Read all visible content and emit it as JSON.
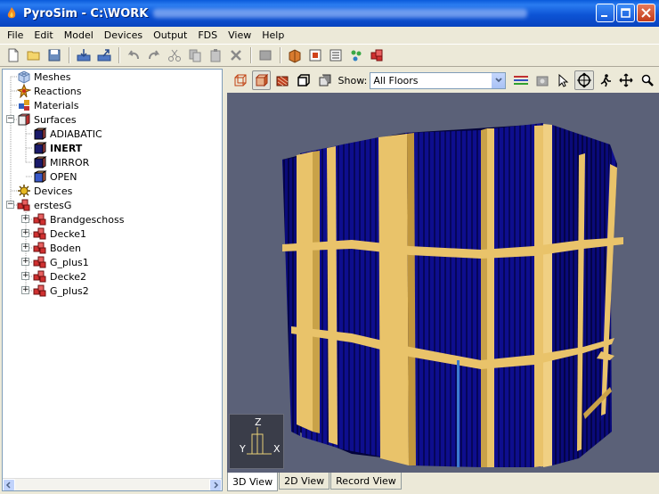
{
  "window": {
    "title": "PyroSim - C:\\WORK"
  },
  "menu": [
    "File",
    "Edit",
    "Model",
    "Devices",
    "Output",
    "FDS",
    "View",
    "Help"
  ],
  "toolbar": {
    "icons": [
      "new-file-icon",
      "open-folder-icon",
      "save-icon",
      "import-icon",
      "export-icon",
      "undo-icon",
      "redo-icon",
      "cut-icon",
      "copy-icon",
      "paste-icon",
      "delete-icon",
      "properties-icon",
      "new-obstruction-icon",
      "new-hole-icon",
      "new-vent-icon",
      "new-particle-icon",
      "new-group-icon"
    ]
  },
  "tree": {
    "items": [
      {
        "label": "Meshes",
        "icon": "mesh-icon",
        "level": 0
      },
      {
        "label": "Reactions",
        "icon": "reaction-icon",
        "level": 0
      },
      {
        "label": "Materials",
        "icon": "material-icon",
        "level": 0
      },
      {
        "label": "Surfaces",
        "icon": "surface-icon",
        "level": 0,
        "expanded": true
      },
      {
        "label": "ADIABATIC",
        "icon": "surface-adiabatic-icon",
        "level": 1
      },
      {
        "label": "INERT",
        "icon": "surface-inert-icon",
        "level": 1,
        "selected": true
      },
      {
        "label": "MIRROR",
        "icon": "surface-mirror-icon",
        "level": 1
      },
      {
        "label": "OPEN",
        "icon": "surface-open-icon",
        "level": 1
      },
      {
        "label": "Devices",
        "icon": "device-icon",
        "level": 0
      },
      {
        "label": "erstesG",
        "icon": "group-icon",
        "level": 0,
        "expanded": true
      },
      {
        "label": "Brandgeschoss",
        "icon": "group-icon",
        "level": 1
      },
      {
        "label": "Decke1",
        "icon": "group-icon",
        "level": 1
      },
      {
        "label": "Boden",
        "icon": "group-icon",
        "level": 1
      },
      {
        "label": "G_plus1",
        "icon": "group-icon",
        "level": 1
      },
      {
        "label": "Decke2",
        "icon": "group-icon",
        "level": 1
      },
      {
        "label": "G_plus2",
        "icon": "group-icon",
        "level": 1
      }
    ]
  },
  "view": {
    "show_label": "Show:",
    "floor_select": "All Floors",
    "axes": {
      "z": "Z",
      "y": "Y",
      "x": "X"
    },
    "tabs": [
      "3D View",
      "2D View",
      "Record View"
    ],
    "active_tab": "3D View"
  },
  "colors": {
    "viewport_bg": "#5b6178",
    "wall_blue": "#0d0d8c",
    "column_gold": "#e9c36a",
    "titlebar": "#0a5bdb"
  }
}
